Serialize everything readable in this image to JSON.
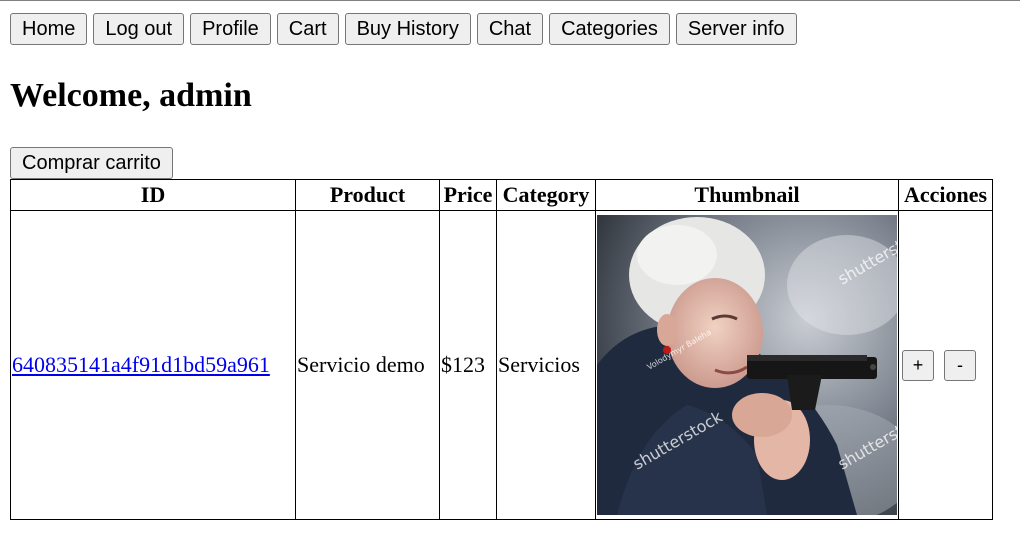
{
  "nav": [
    {
      "label": "Home"
    },
    {
      "label": "Log out"
    },
    {
      "label": "Profile"
    },
    {
      "label": "Cart"
    },
    {
      "label": "Buy History"
    },
    {
      "label": "Chat"
    },
    {
      "label": "Categories"
    },
    {
      "label": "Server info"
    }
  ],
  "welcome": "Welcome, admin",
  "buy_button": "Comprar carrito",
  "table": {
    "headers": [
      "ID",
      "Product",
      "Price",
      "Category",
      "Thumbnail",
      "Acciones"
    ],
    "rows": [
      {
        "id": "640835141a4f91d1bd59a961",
        "product": "Servicio demo",
        "price": "$123",
        "category": "Servicios",
        "thumbnail": {
          "watermarks": [
            "shutterstock",
            "shutterstock",
            "shutterstock",
            "Volodymyr Baleha"
          ]
        },
        "actions": {
          "plus": "+",
          "minus": "-"
        }
      }
    ]
  },
  "colors": {
    "link": "#0000ee",
    "button_bg": "#efefef",
    "button_border": "#767676"
  }
}
